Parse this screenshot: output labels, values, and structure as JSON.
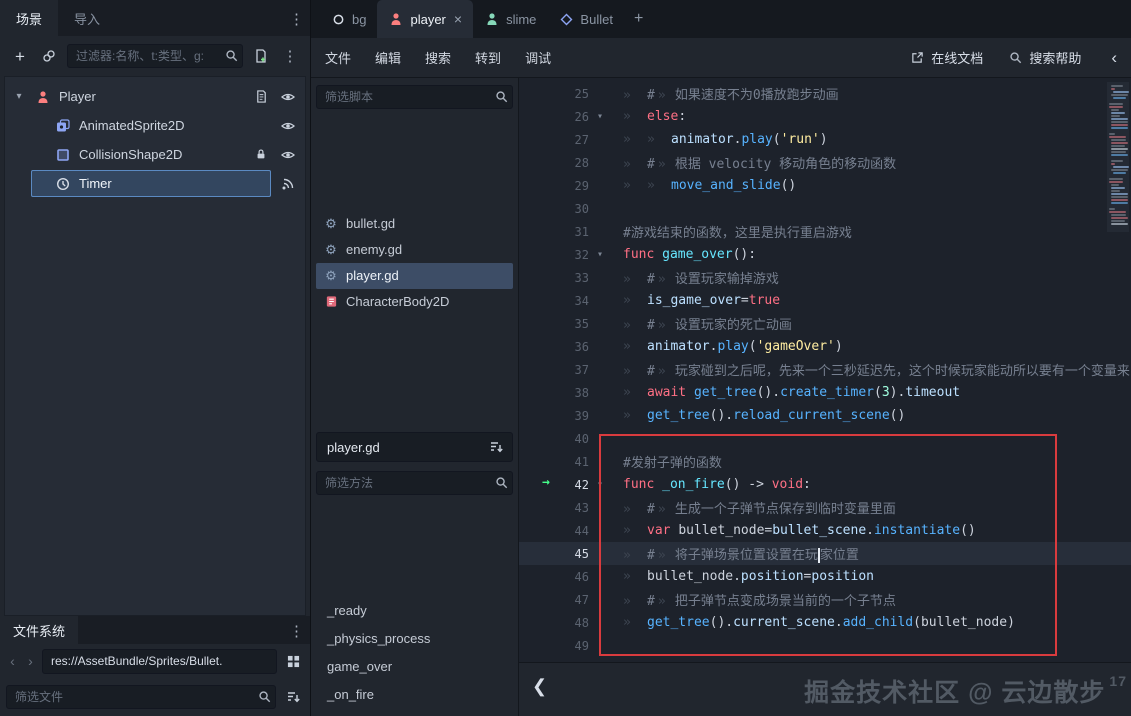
{
  "colors": {
    "panel": "#21262e",
    "editor_bg": "#1d222b",
    "tree_bg": "#262c36",
    "selection": "#33465f",
    "selection_border": "#5b8ac2",
    "keyword": "#ff7085",
    "string": "#ffeda1",
    "function_call": "#57b3ff",
    "function_def": "#66e6ff",
    "member": "#bce0ff",
    "number": "#a1ffe0",
    "comment": "#778090",
    "annotation": "#d93b3e",
    "exec_marker": "#45ff8b"
  },
  "scene_panel": {
    "tabs": [
      {
        "label": "场景",
        "active": true
      },
      {
        "label": "导入",
        "active": false
      }
    ],
    "toolbar": {
      "left_icons": [
        "add-node-icon",
        "instance-scene-icon"
      ],
      "filter_placeholder": "过滤器:名称、t:类型、g:",
      "right_icons": [
        "attach-script-icon",
        "menu-dots-icon"
      ]
    },
    "tree": [
      {
        "label": "Player",
        "depth": 0,
        "icon": "character-icon",
        "expanded": true,
        "trailing": [
          "script-icon",
          "eye-icon"
        ]
      },
      {
        "label": "AnimatedSprite2D",
        "depth": 1,
        "icon": "animated-sprite-icon",
        "trailing": [
          "eye-icon"
        ]
      },
      {
        "label": "CollisionShape2D",
        "depth": 1,
        "icon": "collision-shape-icon",
        "trailing": [
          "lock-icon",
          "eye-icon"
        ]
      },
      {
        "label": "Timer",
        "depth": 1,
        "icon": "timer-icon",
        "selected": true,
        "trailing": [
          "signal-icon"
        ]
      }
    ]
  },
  "filesystem": {
    "title": "文件系统",
    "path": "res://AssetBundle/Sprites/Bullet.",
    "filter_placeholder": "筛选文件",
    "icons": [
      "back-icon",
      "forward-icon",
      "split-view-icon",
      "file-sort-icon"
    ]
  },
  "scene_tabs": {
    "tabs": [
      {
        "label": "bg",
        "icon": "node-circle-icon",
        "active": false
      },
      {
        "label": "player",
        "icon": "character-icon",
        "active": true,
        "closable": true
      },
      {
        "label": "slime",
        "icon": "slime-icon",
        "active": false
      },
      {
        "label": "Bullet",
        "icon": "bullet-scene-icon",
        "active": false
      }
    ],
    "new_tab_icon": "plus-icon"
  },
  "script_menu": {
    "items": [
      "文件",
      "编辑",
      "搜索",
      "转到",
      "调试"
    ],
    "online_docs": "在线文档",
    "search_help": "搜索帮助"
  },
  "script_panel": {
    "filter_scripts_placeholder": "筛选脚本",
    "scripts": [
      {
        "label": "bullet.gd",
        "icon": "gdscript-icon",
        "selected": false
      },
      {
        "label": "enemy.gd",
        "icon": "gdscript-icon",
        "selected": false
      },
      {
        "label": "player.gd",
        "icon": "gdscript-icon",
        "selected": true
      },
      {
        "label": "CharacterBody2D",
        "icon": "class-doc-icon",
        "selected": false
      }
    ],
    "current_script": "player.gd",
    "filter_methods_placeholder": "筛选方法",
    "methods": [
      "_ready",
      "_physics_process",
      "game_over",
      "_on_fire"
    ]
  },
  "code": {
    "current_line": 45,
    "exec_line": 42,
    "annotation_box": {
      "from_line": 40,
      "to_line": 49,
      "color": "#d93b3e"
    },
    "lines": [
      {
        "n": 25,
        "ind": 1,
        "t": [
          [
            "#",
            "c"
          ],
          [
            "»",
            "tm"
          ],
          [
            "如果速度不为0播放跑步动画",
            "c"
          ]
        ]
      },
      {
        "n": 26,
        "ind": 1,
        "fold": true,
        "t": [
          [
            "else",
            "k"
          ],
          [
            ":",
            "p"
          ]
        ]
      },
      {
        "n": 27,
        "ind": 2,
        "t": [
          [
            "animator",
            "m"
          ],
          [
            ".",
            "p"
          ],
          [
            "play",
            "f"
          ],
          [
            "(",
            "p"
          ],
          [
            "'run'",
            "s"
          ],
          [
            ")",
            "p"
          ]
        ]
      },
      {
        "n": 28,
        "ind": 1,
        "t": [
          [
            "#",
            "c"
          ],
          [
            "»",
            "tm"
          ],
          [
            "根据 velocity 移动角色的移动函数",
            "c"
          ]
        ]
      },
      {
        "n": 29,
        "ind": 2,
        "t": [
          [
            "move_and_slide",
            "f"
          ],
          [
            "()",
            "p"
          ]
        ]
      },
      {
        "n": 30,
        "ind": 0,
        "t": []
      },
      {
        "n": 31,
        "ind": 0,
        "t": [
          [
            "#游戏结束的函数，这里是执行重启游戏",
            "c"
          ]
        ]
      },
      {
        "n": 32,
        "ind": 0,
        "fold": true,
        "t": [
          [
            "func",
            "k"
          ],
          [
            " ",
            "p"
          ],
          [
            "game_over",
            "d"
          ],
          [
            "():",
            "p"
          ]
        ]
      },
      {
        "n": 33,
        "ind": 1,
        "t": [
          [
            "#",
            "c"
          ],
          [
            "»",
            "tm"
          ],
          [
            "设置玩家输掉游戏",
            "c"
          ]
        ]
      },
      {
        "n": 34,
        "ind": 1,
        "t": [
          [
            "is_game_over",
            "m"
          ],
          [
            "=",
            "p"
          ],
          [
            "true",
            "k"
          ]
        ]
      },
      {
        "n": 35,
        "ind": 1,
        "t": [
          [
            "#",
            "c"
          ],
          [
            "»",
            "tm"
          ],
          [
            "设置玩家的死亡动画",
            "c"
          ]
        ]
      },
      {
        "n": 36,
        "ind": 1,
        "t": [
          [
            "animator",
            "m"
          ],
          [
            ".",
            "p"
          ],
          [
            "play",
            "f"
          ],
          [
            "(",
            "p"
          ],
          [
            "'gameOver'",
            "s"
          ],
          [
            ")",
            "p"
          ]
        ]
      },
      {
        "n": 37,
        "ind": 1,
        "t": [
          [
            "#",
            "c"
          ],
          [
            "»",
            "tm"
          ],
          [
            "玩家碰到之后呢，先来一个三秒延迟先，这个时候玩家能动所以要有一个变量来",
            "c"
          ]
        ]
      },
      {
        "n": 38,
        "ind": 1,
        "t": [
          [
            "await",
            "k"
          ],
          [
            " ",
            "p"
          ],
          [
            "get_tree",
            "f"
          ],
          [
            "().",
            "p"
          ],
          [
            "create_timer",
            "f"
          ],
          [
            "(",
            "p"
          ],
          [
            "3",
            "n"
          ],
          [
            ").",
            "p"
          ],
          [
            "timeout",
            "m"
          ]
        ]
      },
      {
        "n": 39,
        "ind": 1,
        "t": [
          [
            "get_tree",
            "f"
          ],
          [
            "().",
            "p"
          ],
          [
            "reload_current_scene",
            "f"
          ],
          [
            "()",
            "p"
          ]
        ]
      },
      {
        "n": 40,
        "ind": 0,
        "t": []
      },
      {
        "n": 41,
        "ind": 0,
        "t": [
          [
            "#发射子弹的函数",
            "c"
          ]
        ]
      },
      {
        "n": 42,
        "ind": 0,
        "fold": true,
        "t": [
          [
            "func",
            "k"
          ],
          [
            " ",
            "p"
          ],
          [
            "_on_fire",
            "d"
          ],
          [
            "() ",
            "p"
          ],
          [
            "->",
            "p"
          ],
          [
            " ",
            "p"
          ],
          [
            "void",
            "k"
          ],
          [
            ":",
            "p"
          ]
        ]
      },
      {
        "n": 43,
        "ind": 1,
        "t": [
          [
            "#",
            "c"
          ],
          [
            "»",
            "tm"
          ],
          [
            "生成一个子弹节点保存到临时变量里面",
            "c"
          ]
        ]
      },
      {
        "n": 44,
        "ind": 1,
        "t": [
          [
            "var",
            "k"
          ],
          [
            " ",
            "p"
          ],
          [
            "bullet_node",
            "p"
          ],
          [
            "=",
            "p"
          ],
          [
            "bullet_scene",
            "m"
          ],
          [
            ".",
            "p"
          ],
          [
            "instantiate",
            "f"
          ],
          [
            "()",
            "p"
          ]
        ]
      },
      {
        "n": 45,
        "ind": 1,
        "t": [
          [
            "#",
            "c"
          ],
          [
            "»",
            "tm"
          ],
          [
            "将子弹场景位置设置在玩",
            "c"
          ],
          [
            "|",
            "caret"
          ],
          [
            "家位置",
            "c"
          ]
        ]
      },
      {
        "n": 46,
        "ind": 1,
        "t": [
          [
            "bullet_node",
            "p"
          ],
          [
            ".",
            "p"
          ],
          [
            "position",
            "m"
          ],
          [
            "=",
            "p"
          ],
          [
            "position",
            "m"
          ]
        ]
      },
      {
        "n": 47,
        "ind": 1,
        "t": [
          [
            "#",
            "c"
          ],
          [
            "»",
            "tm"
          ],
          [
            "把子弹节点变成场景当前的一个子节点",
            "c"
          ]
        ]
      },
      {
        "n": 48,
        "ind": 1,
        "t": [
          [
            "get_tree",
            "f"
          ],
          [
            "().",
            "p"
          ],
          [
            "current_scene",
            "m"
          ],
          [
            ".",
            "p"
          ],
          [
            "add_child",
            "f"
          ],
          [
            "(",
            "p"
          ],
          [
            "bullet_node",
            "p"
          ],
          [
            ")",
            "p"
          ]
        ]
      },
      {
        "n": 49,
        "ind": 0,
        "t": []
      }
    ]
  },
  "watermark": {
    "text": "掘金技术社区 @ 云边散步",
    "suffix": "17"
  }
}
